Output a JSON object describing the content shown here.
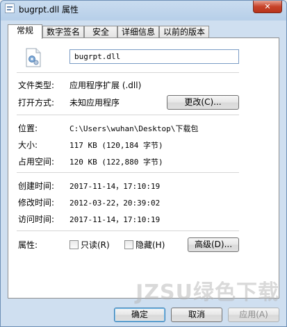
{
  "window": {
    "title": "bugrpt.dll 属性",
    "close_label": "✕"
  },
  "tabs": [
    {
      "label": "常规",
      "active": true
    },
    {
      "label": "数字签名",
      "active": false
    },
    {
      "label": "安全",
      "active": false
    },
    {
      "label": "详细信息",
      "active": false
    },
    {
      "label": "以前的版本",
      "active": false
    }
  ],
  "general": {
    "file_name": "bugrpt.dll",
    "file_type_label": "文件类型:",
    "file_type_value": "应用程序扩展 (.dll)",
    "open_with_label": "打开方式:",
    "open_with_value": "未知应用程序",
    "change_button": "更改(C)...",
    "location_label": "位置:",
    "location_value": "C:\\Users\\wuhan\\Desktop\\下载包",
    "size_label": "大小:",
    "size_value": "117 KB (120,184 字节)",
    "disk_size_label": "占用空间:",
    "disk_size_value": "120 KB (122,880 字节)",
    "created_label": "创建时间:",
    "created_value": "2017-11-14，17:10:19",
    "modified_label": "修改时间:",
    "modified_value": "2012-03-22，20:39:02",
    "accessed_label": "访问时间:",
    "accessed_value": "2017-11-14，17:10:19",
    "attributes_label": "属性:",
    "readonly_label": "只读(R)",
    "hidden_label": "隐藏(H)",
    "advanced_button": "高级(D)..."
  },
  "footer": {
    "ok": "确定",
    "cancel": "取消",
    "apply": "应用(A)"
  },
  "watermark": "JZSU绿色下载"
}
